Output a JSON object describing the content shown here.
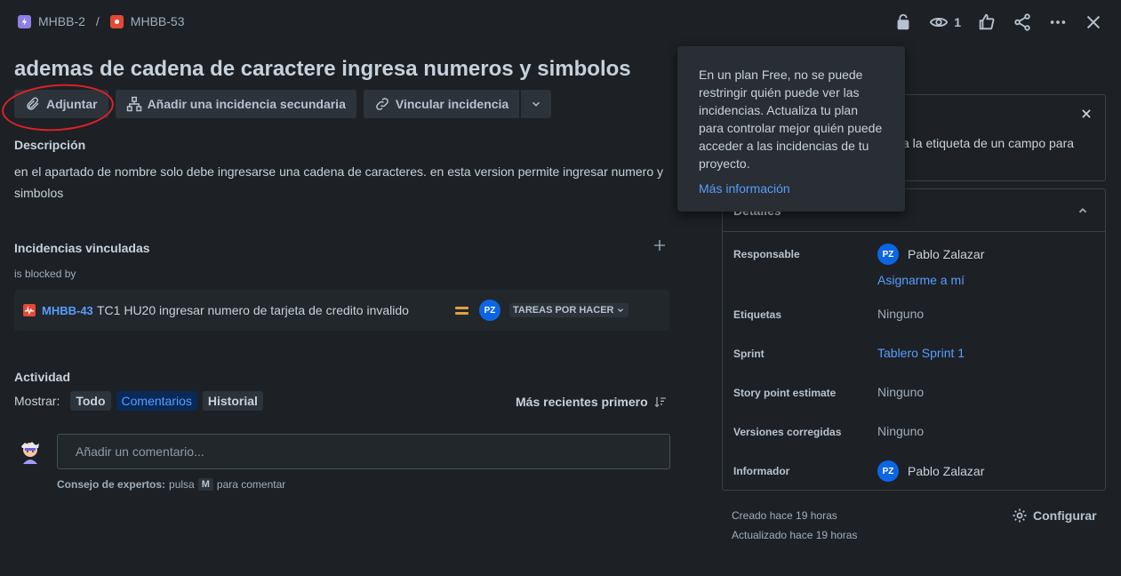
{
  "breadcrumb": {
    "parent": "MHBB-2",
    "separator": "/",
    "current": "MHBB-53"
  },
  "toolbar": {
    "watch_count": "1"
  },
  "issue": {
    "title": "ademas de cadena de caractere ingresa numeros y simbolos"
  },
  "actions": {
    "attach": "Adjuntar",
    "add_child": "Añadir una incidencia secundaria",
    "link_issue": "Vincular incidencia"
  },
  "description": {
    "label": "Descripción",
    "text": "en el apartado de nombre solo debe ingresarse una cadena de caracteres. en esta version permite ingresar numero y simbolos"
  },
  "linked": {
    "label": "Incidencias vinculadas",
    "relation": "is blocked by",
    "item": {
      "key": "MHBB-43",
      "summary": "TC1 HU20 ingresar numero de tarjeta de credito invalido",
      "assignee_initials": "PZ",
      "status": "TAREAS POR HACER"
    }
  },
  "activity": {
    "label": "Actividad",
    "show_label": "Mostrar:",
    "tabs": [
      "Todo",
      "Comentarios",
      "Historial"
    ],
    "sort": "Más recientes primero",
    "comment_placeholder": "Añadir un comentario...",
    "tip_prefix": "Consejo de expertos:",
    "tip_mid": "pulsa",
    "tip_key": "M",
    "tip_suffix": "para comentar"
  },
  "popover": {
    "text": "En un plan Free, no se puede restringir quién puede ver las incidencias. Actualiza tu plan para controlar mejor quién puede acceder a las incidencias de tu proyecto.",
    "link": "Más información"
  },
  "hint_panel": {
    "partial_text": "a la etiqueta de un campo para"
  },
  "details": {
    "title": "Detalles",
    "responsable_label": "Responsable",
    "responsable_initials": "PZ",
    "responsable_name": "Pablo Zalazar",
    "assign_me": "Asignarme a mí",
    "etiquetas_label": "Etiquetas",
    "etiquetas_value": "Ninguno",
    "sprint_label": "Sprint",
    "sprint_value": "Tablero Sprint 1",
    "sp_label": "Story point estimate",
    "sp_value": "Ninguno",
    "versiones_label": "Versiones corregidas",
    "versiones_value": "Ninguno",
    "informador_label": "Informador",
    "informador_initials": "PZ",
    "informador_name": "Pablo Zalazar"
  },
  "footer": {
    "created": "Creado hace 19 horas",
    "updated": "Actualizado hace 19 horas",
    "configure": "Configurar"
  }
}
